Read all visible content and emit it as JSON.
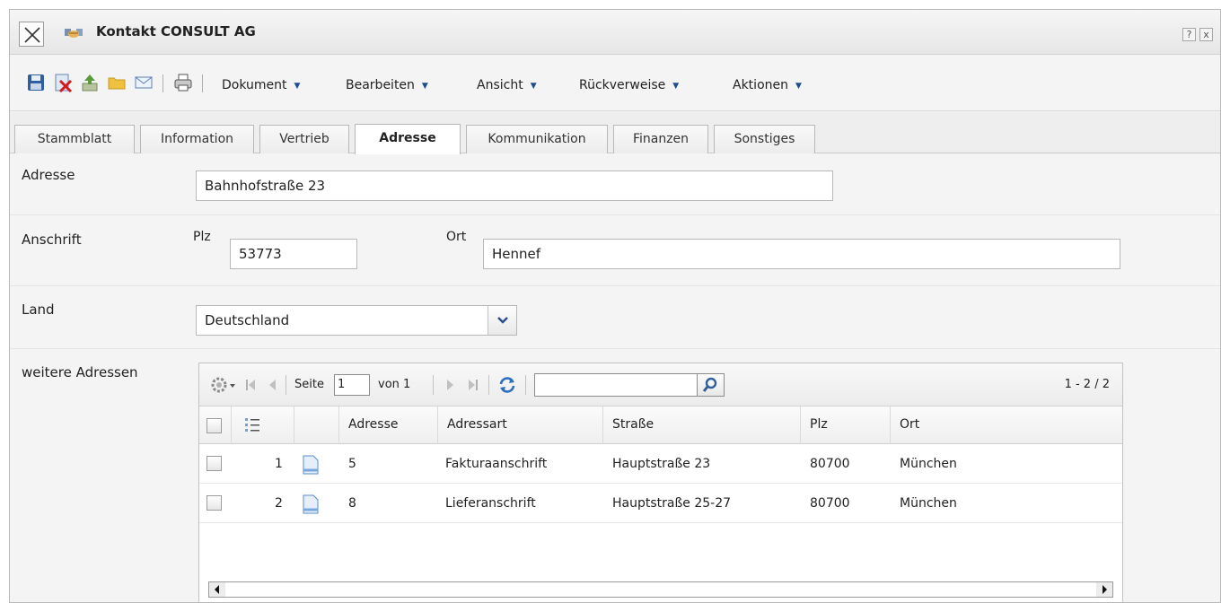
{
  "window": {
    "title": "Kontakt CONSULT AG",
    "help_glyph": "?",
    "close_glyph": "x"
  },
  "toolbar": {
    "icons": [
      "save-icon",
      "delete-icon",
      "upload-icon",
      "folder-icon",
      "mail-icon",
      "print-icon"
    ],
    "menus": [
      "Dokument",
      "Bearbeiten",
      "Ansicht",
      "Rückverweise",
      "Aktionen"
    ],
    "menu_arrow": "▼"
  },
  "tabs": {
    "items": [
      "Stammblatt",
      "Information",
      "Vertrieb",
      "Adresse",
      "Kommunikation",
      "Finanzen",
      "Sonstiges"
    ],
    "active": "Adresse"
  },
  "form": {
    "adresse": {
      "label": "Adresse",
      "value": "Bahnhofstraße 23"
    },
    "anschrift": {
      "label": "Anschrift",
      "plz_label": "Plz",
      "plz_value": "53773",
      "ort_label": "Ort",
      "ort_value": "Hennef"
    },
    "land": {
      "label": "Land",
      "value": "Deutschland"
    },
    "weitere": {
      "label": "weitere Adressen"
    }
  },
  "grid": {
    "pager": {
      "seite_label": "Seite",
      "page": "1",
      "von_label": "von 1",
      "search_value": "",
      "summary": "1 - 2 / 2"
    },
    "columns": [
      "Adresse",
      "Adressart",
      "Straße",
      "Plz",
      "Ort"
    ],
    "rows": [
      {
        "num": "1",
        "adresse": "5",
        "adressart": "Fakturaanschrift",
        "strasse": "Hauptstraße 23",
        "plz": "80700",
        "ort": "München"
      },
      {
        "num": "2",
        "adresse": "8",
        "adressart": "Lieferanschrift",
        "strasse": "Hauptstraße 25-27",
        "plz": "80700",
        "ort": "München"
      }
    ]
  },
  "colors": {
    "accent": "#1f4c8f",
    "border": "#b8b8b8",
    "panel": "#f4f4f4"
  }
}
